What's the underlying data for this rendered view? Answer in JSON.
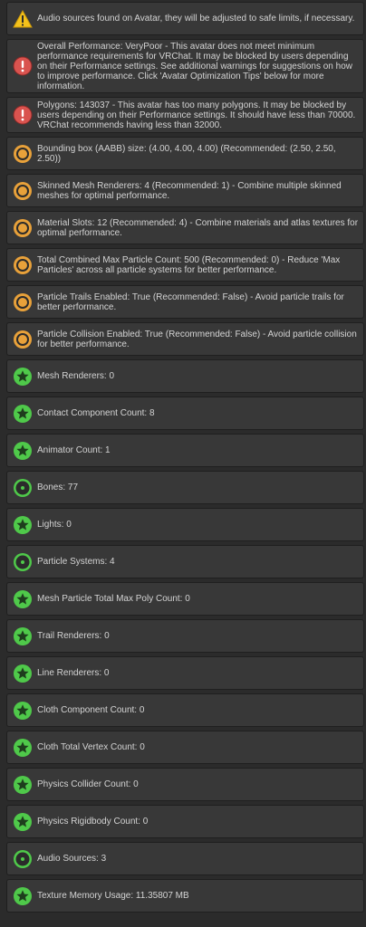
{
  "colors": {
    "warning": "#f4c21b",
    "error": "#d9534f",
    "poor": "#e8a13a",
    "good": "#4fc94a"
  },
  "messages": [
    {
      "icon": "warning-icon",
      "text": "Audio sources found on Avatar, they will be adjusted to safe limits, if necessary."
    },
    {
      "icon": "error-icon",
      "text": "Overall Performance: VeryPoor - This avatar does not meet minimum performance requirements for VRChat. It may be blocked by users depending on their Performance settings. See additional warnings for suggestions on how to improve performance. Click 'Avatar Optimization Tips' below for more information."
    },
    {
      "icon": "error-icon",
      "text": "Polygons: 143037 - This avatar has too many polygons. It may be blocked by users depending on their Performance settings. It should have less than 70000. VRChat recommends having less than 32000."
    },
    {
      "icon": "poor-icon",
      "text": "Bounding box (AABB) size: (4.00, 4.00, 4.00) (Recommended: (2.50, 2.50, 2.50))"
    },
    {
      "icon": "poor-icon",
      "text": "Skinned Mesh Renderers: 4 (Recommended: 1) - Combine multiple skinned meshes for optimal performance."
    },
    {
      "icon": "poor-icon",
      "text": "Material Slots: 12 (Recommended: 4) - Combine materials and atlas textures for optimal performance."
    },
    {
      "icon": "poor-icon",
      "text": "Total Combined Max Particle Count: 500 (Recommended: 0) - Reduce 'Max Particles' across all particle systems for better performance."
    },
    {
      "icon": "poor-icon",
      "text": "Particle Trails Enabled: True (Recommended: False) - Avoid particle trails for better performance."
    },
    {
      "icon": "poor-icon",
      "text": "Particle Collision Enabled: True (Recommended: False) - Avoid particle collision for better performance."
    },
    {
      "icon": "star-icon",
      "text": "Mesh Renderers: 0"
    },
    {
      "icon": "star-icon",
      "text": "Contact Component Count: 8"
    },
    {
      "icon": "star-icon",
      "text": "Animator Count: 1"
    },
    {
      "icon": "good-icon",
      "text": "Bones: 77"
    },
    {
      "icon": "star-icon",
      "text": "Lights: 0"
    },
    {
      "icon": "good-icon",
      "text": "Particle Systems: 4"
    },
    {
      "icon": "star-icon",
      "text": "Mesh Particle Total Max Poly Count: 0"
    },
    {
      "icon": "star-icon",
      "text": "Trail Renderers: 0"
    },
    {
      "icon": "star-icon",
      "text": "Line Renderers: 0"
    },
    {
      "icon": "star-icon",
      "text": "Cloth Component Count: 0"
    },
    {
      "icon": "star-icon",
      "text": "Cloth Total Vertex Count: 0"
    },
    {
      "icon": "star-icon",
      "text": "Physics Collider Count: 0"
    },
    {
      "icon": "star-icon",
      "text": "Physics Rigidbody Count: 0"
    },
    {
      "icon": "good-icon",
      "text": "Audio Sources: 3"
    },
    {
      "icon": "star-icon",
      "text": "Texture Memory Usage: 11.35807 MB"
    }
  ]
}
